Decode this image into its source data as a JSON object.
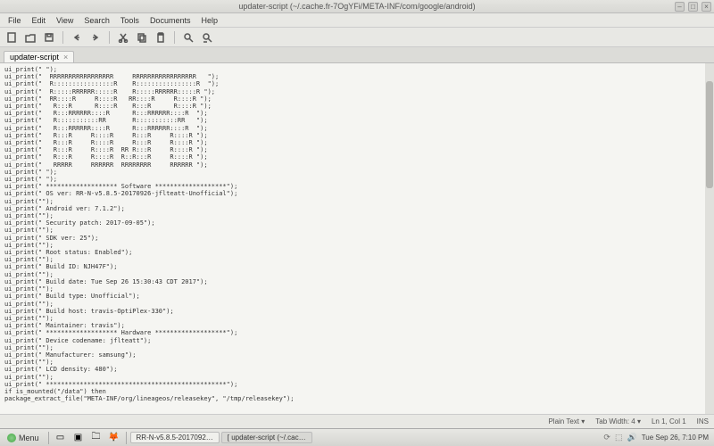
{
  "window": {
    "title": "updater-script (~/.cache.fr-7OgYFi/META-INF/com/google/android)"
  },
  "menu": {
    "file": "File",
    "edit": "Edit",
    "view": "View",
    "search": "Search",
    "tools": "Tools",
    "documents": "Documents",
    "help": "Help"
  },
  "tab": {
    "name": "updater-script"
  },
  "status": {
    "lang": "Plain Text  ▾",
    "tabwidth": "Tab Width: 4  ▾",
    "pos": "Ln 1, Col 1",
    "mode": "INS"
  },
  "taskbar": {
    "menu": "Menu",
    "task1": "RR-N-v5.8.5-2017092…",
    "task2": "[ updater-script (~/.cac…",
    "date": "Tue Sep 26,  7:10 PM"
  },
  "code": "ui_print(\" \");\nui_print(\"  RRRRRRRRRRRRRRRRR     RRRRRRRRRRRRRRRRR   \");\nui_print(\"  R::::::::::::::::R    R::::::::::::::::R  \");\nui_print(\"  R:::::RRRRRR:::::R    R:::::RRRRRR:::::R \");\nui_print(\"  RR::::R     R::::R   RR::::R     R::::R \");\nui_print(\"   R:::R      R::::R    R:::R      R::::R \");\nui_print(\"   R:::RRRRRR::::R      R:::RRRRRR::::R  \");\nui_print(\"   R:::::::::::RR       R:::::::::::RR   \");\nui_print(\"   R:::RRRRRR::::R      R:::RRRRRR::::R  \");\nui_print(\"   R:::R     R::::R     R:::R     R::::R \");\nui_print(\"   R:::R     R::::R     R:::R     R::::R \");\nui_print(\"   R:::R     R::::R  RR R:::R     R::::R \");\nui_print(\"   R:::R     R::::R  R::R:::R     R::::R \");\nui_print(\"   RRRRR     RRRRRR  RRRRRRRR     RRRRRR \");\nui_print(\" \");\nui_print(\" \");\nui_print(\" ******************* Software *******************\");\nui_print(\" OS ver: RR-N-v5.8.5-20170926-jflteatt-Unofficial\");\nui_print(\"\");\nui_print(\" Android ver: 7.1.2\");\nui_print(\"\");\nui_print(\" Security patch: 2017-09-05\");\nui_print(\"\");\nui_print(\" SDK ver: 25\");\nui_print(\"\");\nui_print(\" Root status: Enabled\");\nui_print(\"\");\nui_print(\" Build ID: NJH47F\");\nui_print(\"\");\nui_print(\" Build date: Tue Sep 26 15:30:43 CDT 2017\");\nui_print(\"\");\nui_print(\" Build type: Unofficial\");\nui_print(\"\");\nui_print(\" Build host: travis-OptiPlex-330\");\nui_print(\"\");\nui_print(\" Maintainer: travis\");\nui_print(\" ******************* Hardware *******************\");\nui_print(\" Device codename: jflteatt\");\nui_print(\"\");\nui_print(\" Manufacturer: samsung\");\nui_print(\"\");\nui_print(\" LCD density: 480\");\nui_print(\"\");\nui_print(\" ************************************************\");\nif is_mounted(\"/data\") then\npackage_extract_file(\"META-INF/org/lineageos/releasekey\", \"/tmp/releasekey\");"
}
